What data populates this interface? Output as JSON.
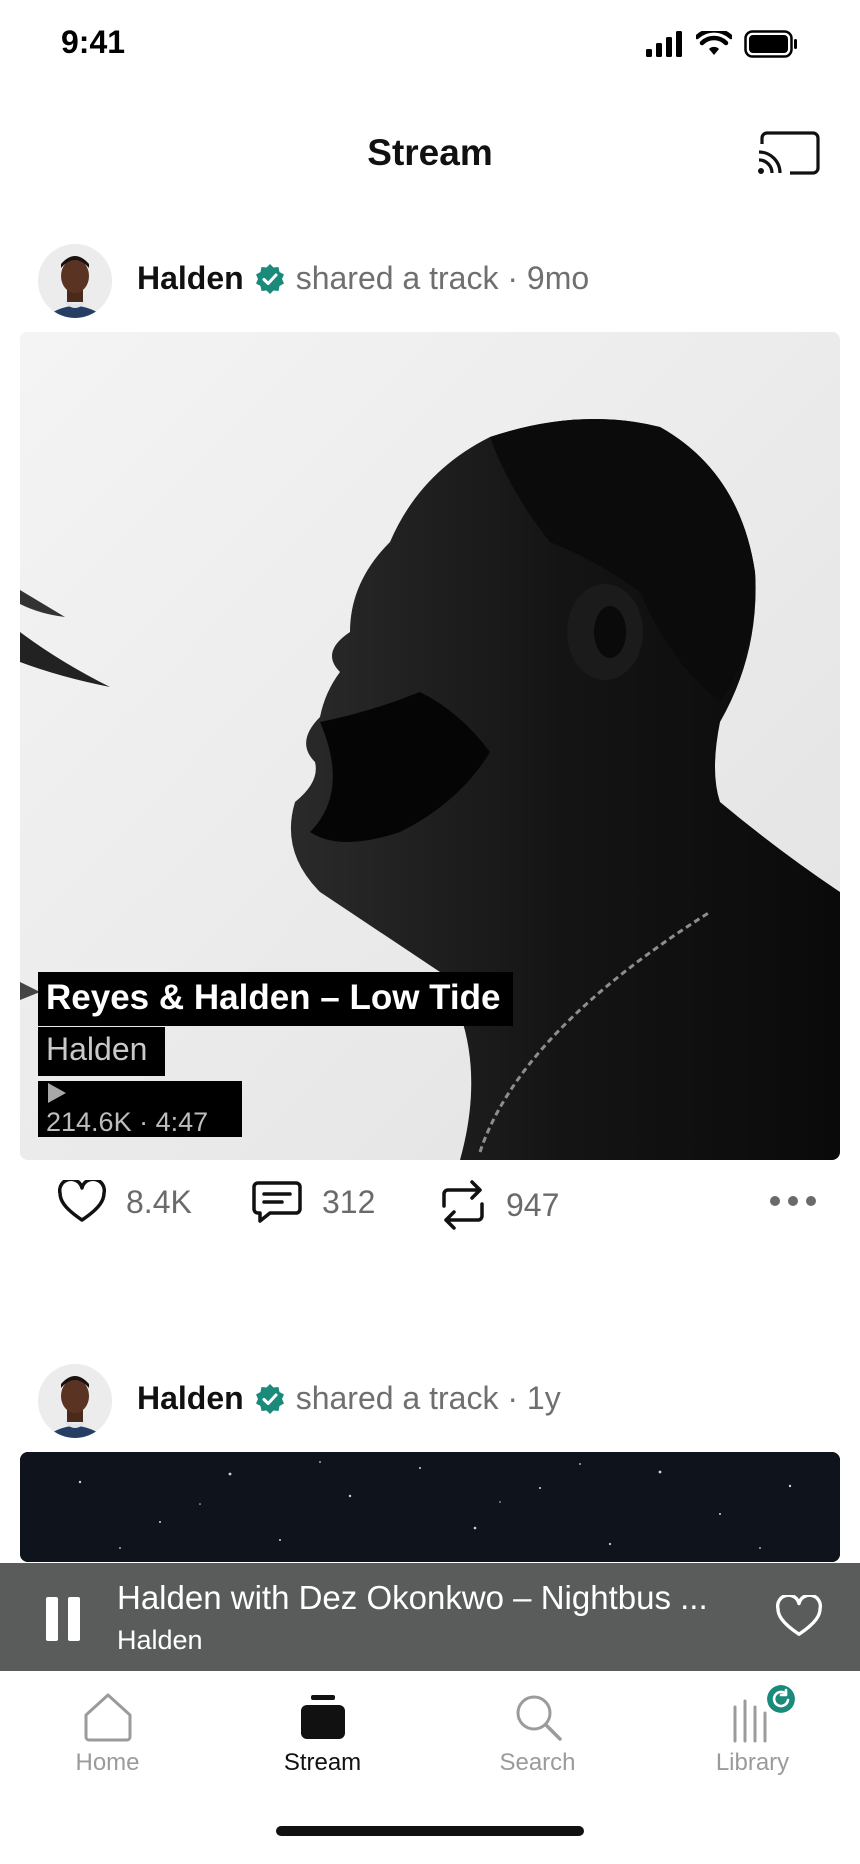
{
  "status_bar": {
    "time": "9:41",
    "icons": [
      "signal-icon",
      "wifi-icon",
      "battery-icon"
    ]
  },
  "header": {
    "title": "Stream",
    "cast_icon": "cast-icon"
  },
  "posts": [
    {
      "user": "Halden",
      "verified": true,
      "action": "shared a track · 9mo",
      "track": {
        "title": "Reyes & Halden – Low Tide",
        "artist": "Halden",
        "stats": "214.6K · 4:47"
      },
      "likes": "8.4K",
      "comments": "312",
      "reposts": "947"
    },
    {
      "user": "Halden",
      "verified": true,
      "action": "shared a track · 1y"
    }
  ],
  "mini_player": {
    "title": "Halden with Dez Okonkwo – Nightbus ...",
    "artist": "Halden"
  },
  "tabs": [
    {
      "label": "Home",
      "icon": "home-icon",
      "active": false
    },
    {
      "label": "Stream",
      "icon": "stream-icon",
      "active": true
    },
    {
      "label": "Search",
      "icon": "search-icon",
      "active": false
    },
    {
      "label": "Library",
      "icon": "library-icon",
      "active": false
    }
  ],
  "colors": {
    "accent": "#1a8a7a",
    "mini_player_bg": "#5a5c5c",
    "text_secondary": "#6f6f6f"
  }
}
